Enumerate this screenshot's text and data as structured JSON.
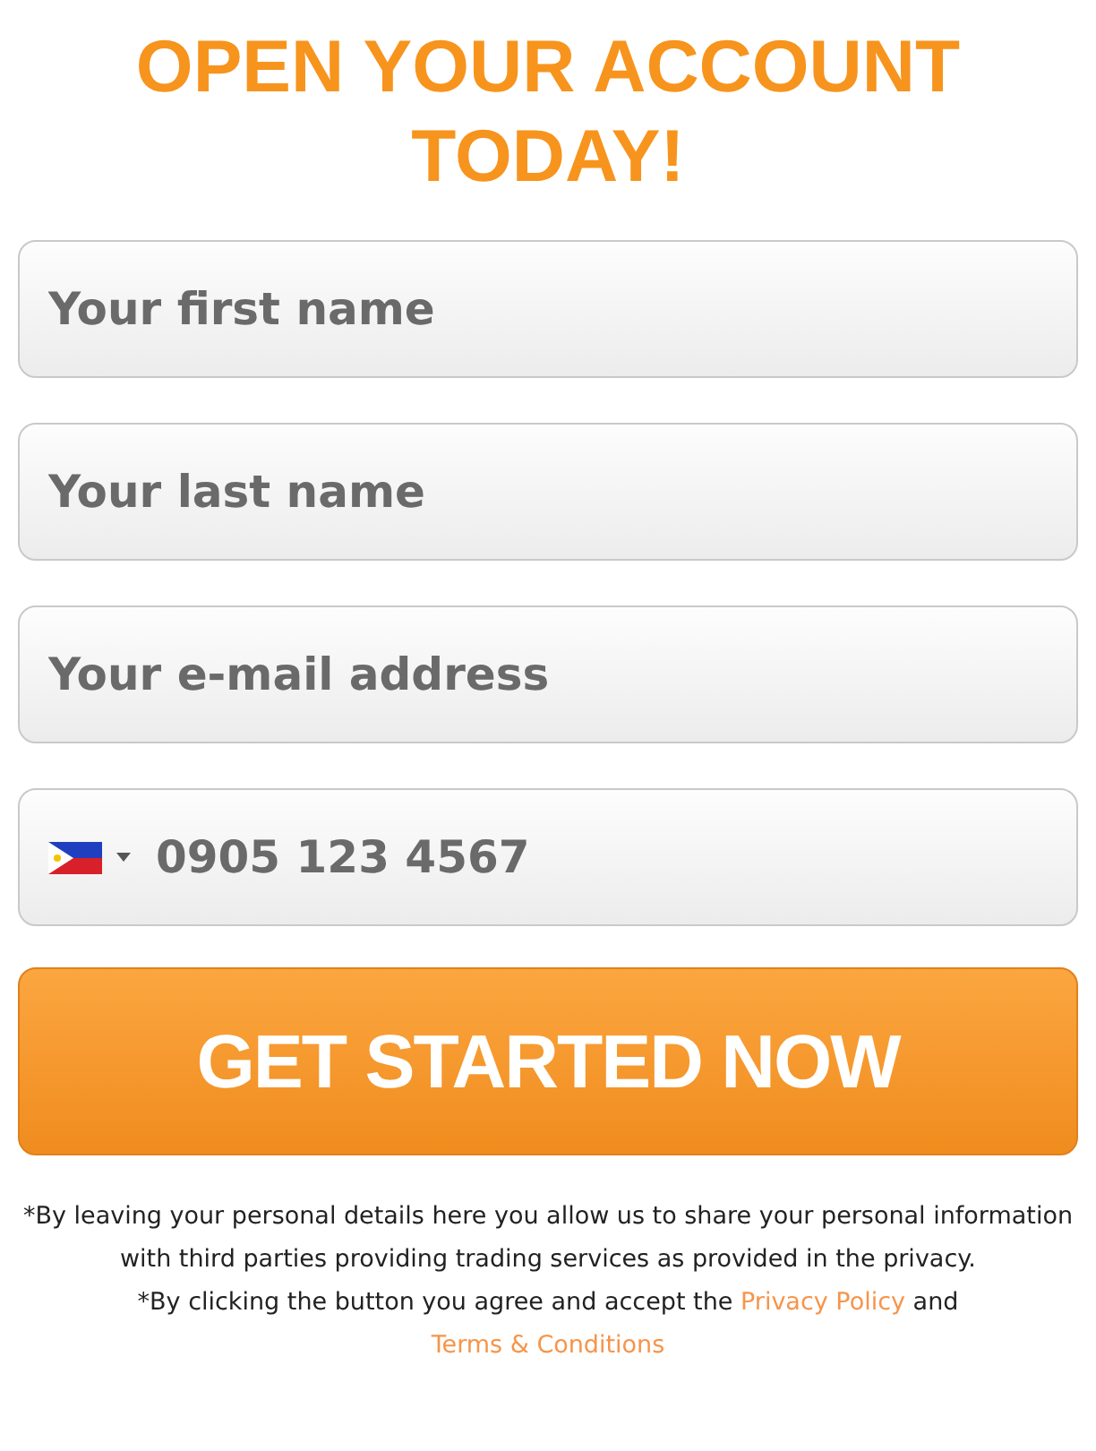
{
  "title": "OPEN YOUR ACCOUNT TODAY!",
  "fields": [
    {
      "placeholder": "Your first name"
    },
    {
      "placeholder": "Your last name"
    },
    {
      "placeholder": "Your e-mail address"
    }
  ],
  "phone": {
    "value": "0905 123 4567"
  },
  "submit_button": {
    "label": "GET STARTED NOW"
  },
  "disclaimer": "*By leaving your personal details here you allow us to share your personal information with third parties providing trading services as provided in the privacy.",
  "consent": {
    "text": "*By clicking the button you agree and accept the",
    "privacy_link": "Privacy Policy",
    "joiner": "and",
    "terms_link": "Terms & Conditions"
  }
}
